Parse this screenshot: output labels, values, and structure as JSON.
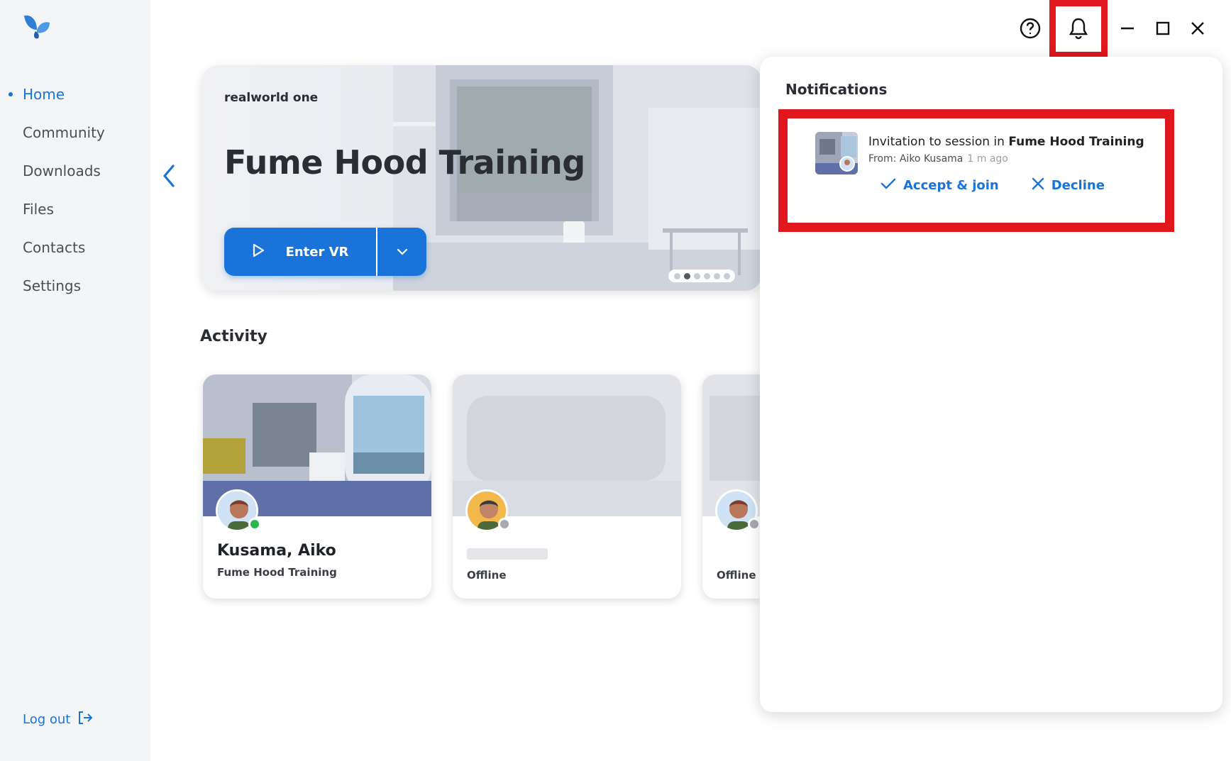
{
  "sidebar": {
    "logo": "butterfly-logo",
    "items": [
      {
        "label": "Home",
        "active": true
      },
      {
        "label": "Community",
        "active": false
      },
      {
        "label": "Downloads",
        "active": false
      },
      {
        "label": "Files",
        "active": false
      },
      {
        "label": "Contacts",
        "active": false
      },
      {
        "label": "Settings",
        "active": false
      }
    ],
    "logout_label": "Log out"
  },
  "window_controls": {
    "icons": [
      "help-icon",
      "bell-icon",
      "minimize-icon",
      "maximize-icon",
      "close-icon"
    ]
  },
  "hero": {
    "subtitle": "realworld one",
    "title": "Fume Hood Training",
    "enter_label": "Enter VR",
    "slides_total": 6,
    "slide_active": 2
  },
  "activity": {
    "title": "Activity",
    "cards": [
      {
        "name": "Kusama, Aiko",
        "subtitle": "Fume Hood Training",
        "status": "online"
      },
      {
        "name": "",
        "subtitle": "Offline",
        "status": "offline"
      },
      {
        "name": "",
        "subtitle": "Offline",
        "status": "offline"
      }
    ]
  },
  "notifications": {
    "title": "Notifications",
    "item": {
      "text_prefix": "Invitation to session in ",
      "session": "Fume Hood Training",
      "from": "From: Aiko Kusama",
      "time": "1 m ago",
      "accept_label": "Accept & join",
      "decline_label": "Decline"
    }
  },
  "colors": {
    "accent": "#1a73d8",
    "highlight": "#e0171c",
    "online": "#2bb84a",
    "offline": "#a6a9ae",
    "sidebar_bg": "#f4f5f7"
  }
}
